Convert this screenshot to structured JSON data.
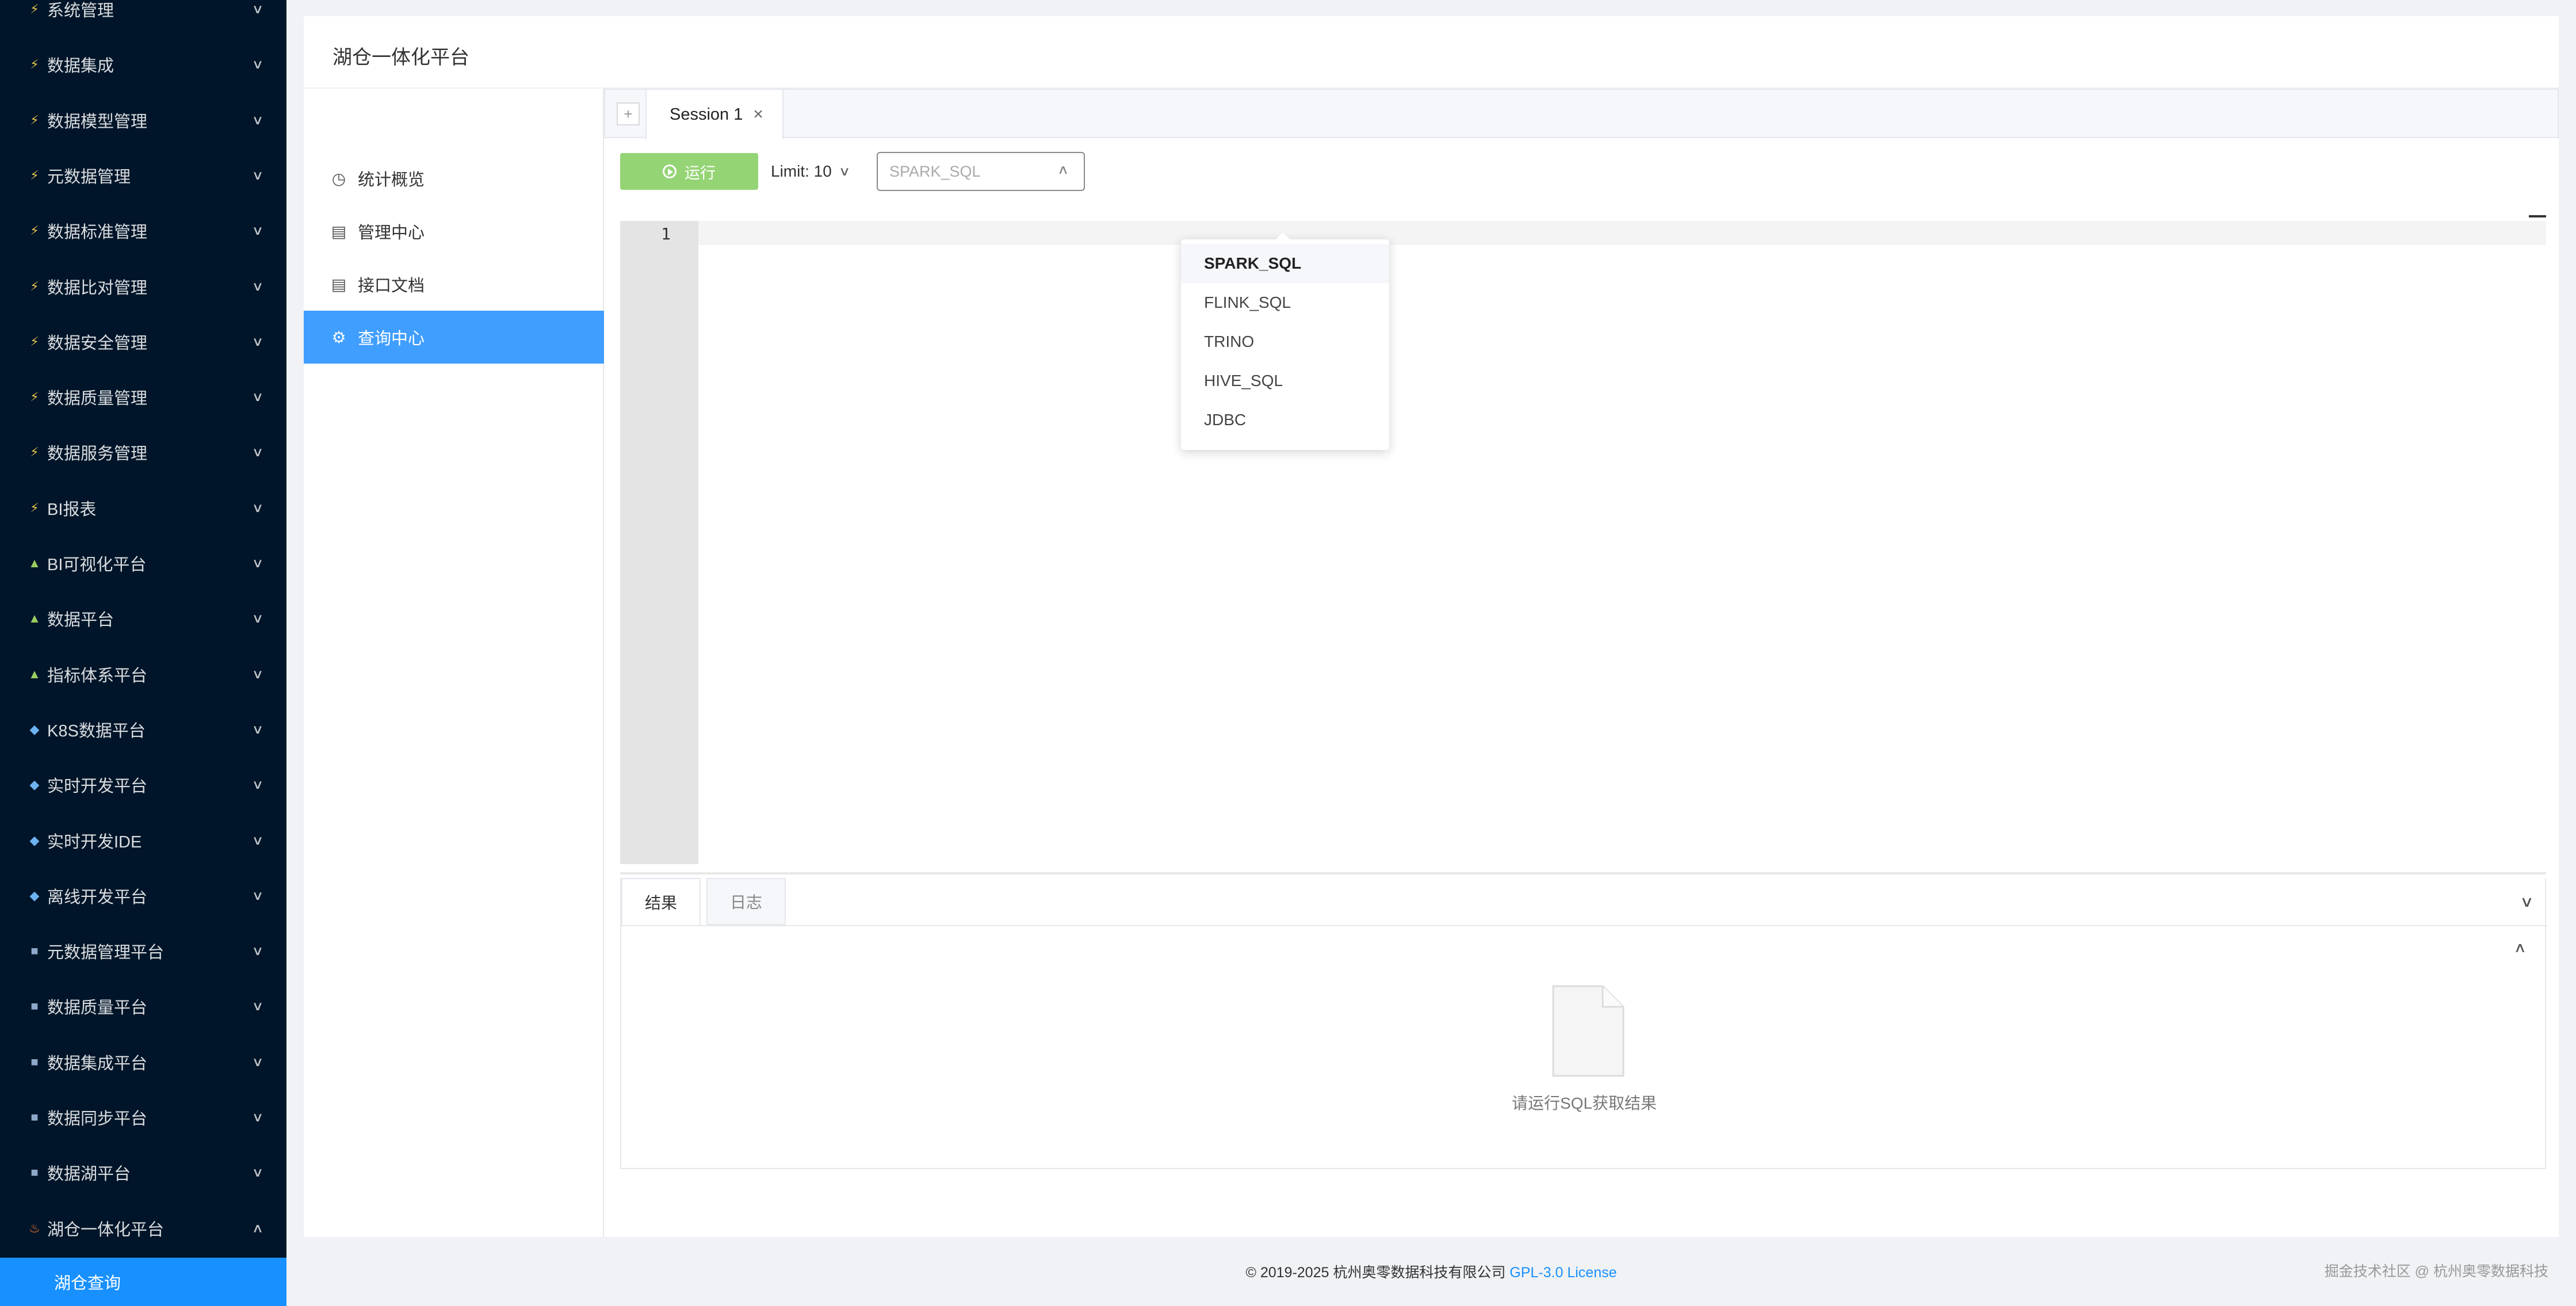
{
  "sidebar": {
    "items": [
      {
        "label": "系统管理",
        "icon": "bolt-icon",
        "glyph": "⚡",
        "kind": "bolt"
      },
      {
        "label": "数据集成",
        "icon": "bolt-icon",
        "glyph": "⚡",
        "kind": "bolt"
      },
      {
        "label": "数据模型管理",
        "icon": "bolt-icon",
        "glyph": "⚡",
        "kind": "bolt"
      },
      {
        "label": "元数据管理",
        "icon": "bolt-icon",
        "glyph": "⚡",
        "kind": "bolt"
      },
      {
        "label": "数据标准管理",
        "icon": "bolt-icon",
        "glyph": "⚡",
        "kind": "bolt"
      },
      {
        "label": "数据比对管理",
        "icon": "bolt-icon",
        "glyph": "⚡",
        "kind": "bolt"
      },
      {
        "label": "数据安全管理",
        "icon": "bolt-icon",
        "glyph": "⚡",
        "kind": "bolt"
      },
      {
        "label": "数据质量管理",
        "icon": "bolt-icon",
        "glyph": "⚡",
        "kind": "bolt"
      },
      {
        "label": "数据服务管理",
        "icon": "bolt-icon",
        "glyph": "⚡",
        "kind": "bolt"
      },
      {
        "label": "BI报表",
        "icon": "bolt-icon",
        "glyph": "⚡",
        "kind": "bolt"
      },
      {
        "label": "BI可视化平台",
        "icon": "mountain-icon",
        "glyph": "▲",
        "kind": "mountain"
      },
      {
        "label": "数据平台",
        "icon": "mountain-icon",
        "glyph": "▲",
        "kind": "mountain"
      },
      {
        "label": "指标体系平台",
        "icon": "mountain-icon",
        "glyph": "▲",
        "kind": "mountain"
      },
      {
        "label": "K8S数据平台",
        "icon": "gem-icon",
        "glyph": "◆",
        "kind": "gem"
      },
      {
        "label": "实时开发平台",
        "icon": "gem-icon",
        "glyph": "◆",
        "kind": "gem"
      },
      {
        "label": "实时开发IDE",
        "icon": "gem-icon",
        "glyph": "◆",
        "kind": "gem"
      },
      {
        "label": "离线开发平台",
        "icon": "gem-icon",
        "glyph": "◆",
        "kind": "gem"
      },
      {
        "label": "元数据管理平台",
        "icon": "database-icon",
        "glyph": "■",
        "kind": "db"
      },
      {
        "label": "数据质量平台",
        "icon": "database-icon",
        "glyph": "■",
        "kind": "db"
      },
      {
        "label": "数据集成平台",
        "icon": "database-icon",
        "glyph": "■",
        "kind": "db"
      },
      {
        "label": "数据同步平台",
        "icon": "database-icon",
        "glyph": "■",
        "kind": "db"
      },
      {
        "label": "数据湖平台",
        "icon": "database-icon",
        "glyph": "■",
        "kind": "db"
      },
      {
        "label": "湖仓一体化平台",
        "icon": "fire-icon",
        "glyph": "♨",
        "kind": "fire",
        "expanded": true
      }
    ],
    "active_sub": "湖仓查询"
  },
  "header": {
    "title": "湖仓一体化平台"
  },
  "inner_menu": [
    {
      "label": "统计概览",
      "icon": "dashboard-icon",
      "glyph": "◷"
    },
    {
      "label": "管理中心",
      "icon": "clipboard-icon",
      "glyph": "▤"
    },
    {
      "label": "接口文档",
      "icon": "document-icon",
      "glyph": "▤"
    },
    {
      "label": "查询中心",
      "icon": "cpu-icon",
      "glyph": "⚙",
      "active": true
    }
  ],
  "query": {
    "tab_label": "Session 1",
    "run_label": "运行",
    "limit_label": "Limit: 10",
    "engine_placeholder": "SPARK_SQL",
    "engine_options": [
      "SPARK_SQL",
      "FLINK_SQL",
      "TRINO",
      "HIVE_SQL",
      "JDBC"
    ],
    "selected_engine": "SPARK_SQL",
    "line_number": "1"
  },
  "results": {
    "tab_result": "结果",
    "tab_log": "日志",
    "empty_text": "请运行SQL获取结果"
  },
  "footer": {
    "copyright": "© 2019-2025 杭州奥零数据科技有限公司 ",
    "license": "GPL-3.0 License",
    "watermark": "掘金技术社区 @ 杭州奥零数据科技"
  },
  "colors": {
    "sidebar_bg": "#001529",
    "active_blue": "#1890ff",
    "menu_active": "#409eff",
    "run_green": "#95d475"
  }
}
